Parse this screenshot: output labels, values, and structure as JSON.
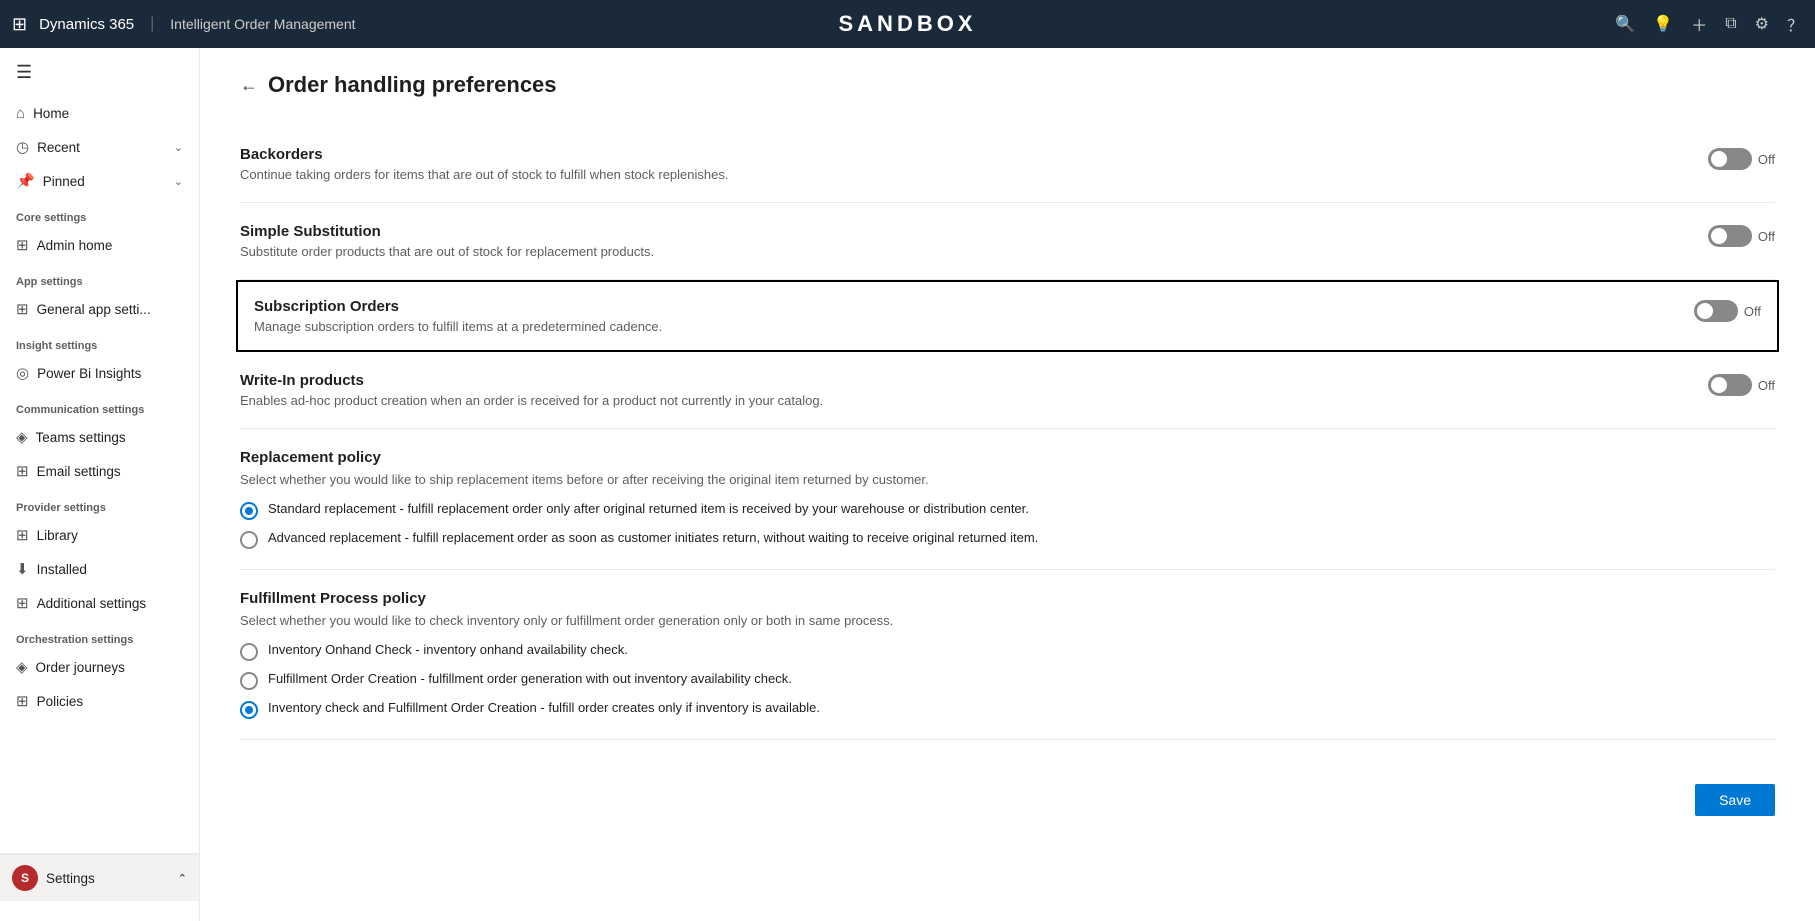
{
  "topNav": {
    "appName": "Dynamics 365",
    "divider": "|",
    "moduleName": "Intelligent Order Management",
    "sandboxTitle": "SANDBOX",
    "icons": [
      "search",
      "lightbulb",
      "plus",
      "filter",
      "settings",
      "help"
    ]
  },
  "sidebar": {
    "hamburger": "☰",
    "navItems": [
      {
        "id": "home",
        "icon": "⌂",
        "label": "Home"
      },
      {
        "id": "recent",
        "icon": "◷",
        "label": "Recent",
        "hasChevron": true
      },
      {
        "id": "pinned",
        "icon": "📌",
        "label": "Pinned",
        "hasChevron": true
      }
    ],
    "sections": [
      {
        "label": "Core settings",
        "items": [
          {
            "id": "admin-home",
            "icon": "⊞",
            "label": "Admin home"
          }
        ]
      },
      {
        "label": "App settings",
        "items": [
          {
            "id": "general-app",
            "icon": "⊞",
            "label": "General app setti..."
          }
        ]
      },
      {
        "label": "Insight settings",
        "items": [
          {
            "id": "power-bi",
            "icon": "◎",
            "label": "Power Bi Insights"
          }
        ]
      },
      {
        "label": "Communication settings",
        "items": [
          {
            "id": "teams",
            "icon": "◈",
            "label": "Teams settings"
          },
          {
            "id": "email",
            "icon": "⊞",
            "label": "Email settings"
          }
        ]
      },
      {
        "label": "Provider settings",
        "items": [
          {
            "id": "library",
            "icon": "⊞",
            "label": "Library"
          },
          {
            "id": "installed",
            "icon": "⬇",
            "label": "Installed"
          },
          {
            "id": "additional",
            "icon": "⊞",
            "label": "Additional settings"
          }
        ]
      },
      {
        "label": "Orchestration settings",
        "items": [
          {
            "id": "order-journeys",
            "icon": "◈",
            "label": "Order journeys"
          },
          {
            "id": "policies",
            "icon": "⊞",
            "label": "Policies"
          }
        ]
      }
    ],
    "footer": {
      "avatar": "S",
      "label": "Settings",
      "hasChevron": true
    }
  },
  "page": {
    "backLabel": "←",
    "title": "Order handling preferences",
    "sections": [
      {
        "id": "backorders",
        "title": "Backorders",
        "description": "Continue taking orders for items that are out of stock to fulfill when stock replenishes.",
        "toggle": true,
        "toggleState": false,
        "toggleLabel": "Off",
        "highlighted": false,
        "hasRadio": false
      },
      {
        "id": "simple-substitution",
        "title": "Simple Substitution",
        "description": "Substitute order products that are out of stock for replacement products.",
        "toggle": true,
        "toggleState": false,
        "toggleLabel": "Off",
        "highlighted": false,
        "hasRadio": false
      },
      {
        "id": "subscription-orders",
        "title": "Subscription Orders",
        "description": "Manage subscription orders to fulfill items at a predetermined cadence.",
        "toggle": true,
        "toggleState": false,
        "toggleLabel": "Off",
        "highlighted": true,
        "hasRadio": false
      },
      {
        "id": "write-in-products",
        "title": "Write-In products",
        "description": "Enables ad-hoc product creation when an order is received for a product not currently in your catalog.",
        "toggle": true,
        "toggleState": false,
        "toggleLabel": "Off",
        "highlighted": false,
        "hasRadio": false
      },
      {
        "id": "replacement-policy",
        "title": "Replacement policy",
        "description": "Select whether you would like to ship replacement items before or after receiving the original item returned by customer.",
        "toggle": false,
        "highlighted": false,
        "hasRadio": true,
        "radioOptions": [
          {
            "id": "standard-replacement",
            "label": "Standard replacement - fulfill replacement order only after original returned item is received by your warehouse or distribution center.",
            "checked": true
          },
          {
            "id": "advanced-replacement",
            "label": "Advanced replacement - fulfill replacement order as soon as customer initiates return, without waiting to receive original returned item.",
            "checked": false
          }
        ]
      },
      {
        "id": "fulfillment-process",
        "title": "Fulfillment Process policy",
        "description": "Select whether you would like to check inventory only or fulfillment order generation only or both in same process.",
        "toggle": false,
        "highlighted": false,
        "hasRadio": true,
        "radioOptions": [
          {
            "id": "inventory-onhand",
            "label": "Inventory Onhand Check - inventory onhand availability check.",
            "checked": false
          },
          {
            "id": "fulfillment-order-creation",
            "label": "Fulfillment Order Creation - fulfillment order generation with out inventory availability check.",
            "checked": false
          },
          {
            "id": "inventory-and-fulfillment",
            "label": "Inventory check and Fulfillment Order Creation - fulfill order creates only if inventory is available.",
            "checked": true
          }
        ]
      }
    ],
    "saveButton": "Save"
  }
}
